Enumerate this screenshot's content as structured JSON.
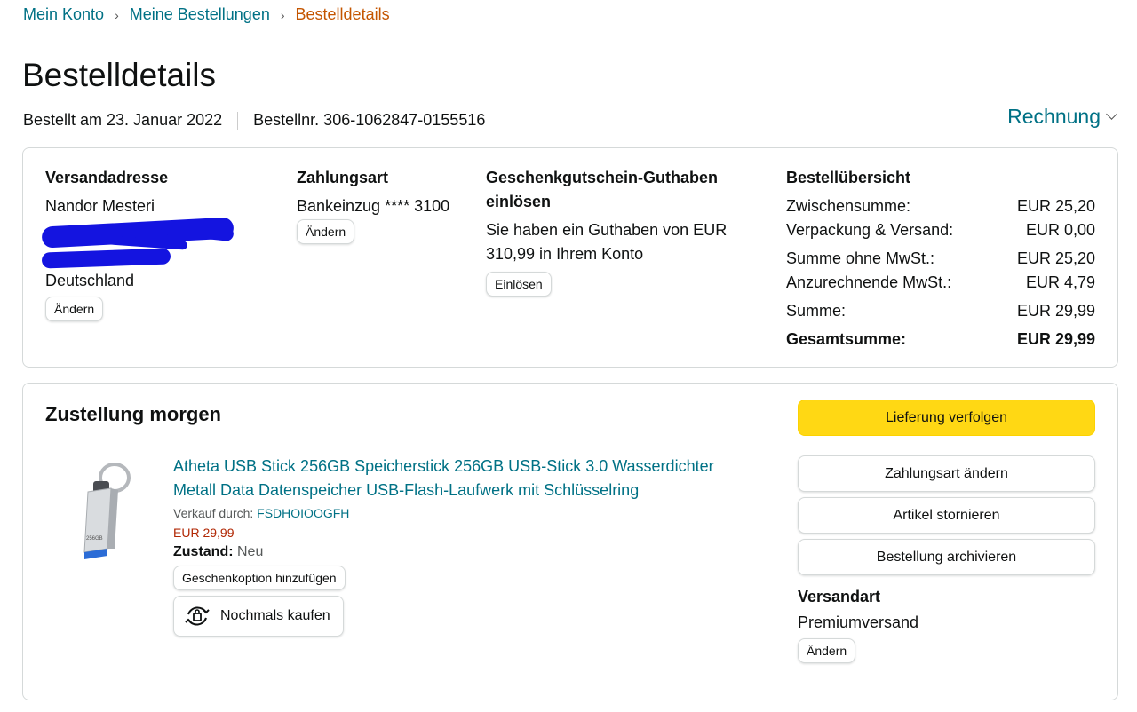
{
  "breadcrumb": {
    "items": [
      "Mein Konto",
      "Meine Bestellungen"
    ],
    "current": "Bestelldetails"
  },
  "page": {
    "title": "Bestelldetails",
    "ordered_on": "Bestellt am 23. Januar 2022",
    "order_number": "Bestellnr. 306-1062847-0155516",
    "invoice_label": "Rechnung"
  },
  "address": {
    "title": "Versandadresse",
    "name": "Nandor Mesteri",
    "country": "Deutschland",
    "change_label": "Ändern"
  },
  "payment": {
    "title": "Zahlungsart",
    "method": "Bankeinzug **** 3100",
    "change_label": "Ändern"
  },
  "giftcard": {
    "title": "Geschenkgutschein-Guthaben einlösen",
    "text": "Sie haben ein Guthaben von EUR 310,99 in Ihrem Konto",
    "redeem_label": "Einlösen"
  },
  "summary": {
    "title": "Bestellübersicht",
    "rows": [
      {
        "label": "Zwischensumme:",
        "value": "EUR 25,20"
      },
      {
        "label": "Verpackung & Versand:",
        "value": "EUR 0,00"
      },
      {
        "label": "Summe ohne MwSt.:",
        "value": "EUR 25,20"
      },
      {
        "label": "Anzurechnende MwSt.:",
        "value": "EUR 4,79"
      },
      {
        "label": "Summe:",
        "value": "EUR 29,99"
      }
    ],
    "total_label": "Gesamtsumme:",
    "total_value": "EUR 29,99"
  },
  "shipment": {
    "title": "Zustellung morgen",
    "product_title": "Atheta USB Stick 256GB Speicherstick 256GB USB-Stick 3.0 Wasserdichter Metall Data Datenspeicher USB-Flash-Laufwerk mit Schlüsselring",
    "seller_prefix": "Verkauf durch: ",
    "seller": "FSDHOIOOGFH",
    "price": "EUR 29,99",
    "condition_label": "Zustand:",
    "condition_value": " Neu",
    "gift_label": "Geschenkoption hinzufügen",
    "rebuy_label": "Nochmals kaufen",
    "product_image_label": "256GB"
  },
  "actions": {
    "track": "Lieferung verfolgen",
    "change_payment": "Zahlungsart ändern",
    "cancel": "Artikel stornieren",
    "archive": "Bestellung archivieren",
    "ship_method_title": "Versandart",
    "ship_method": "Premiumversand",
    "change_label": "Ändern"
  },
  "colors": {
    "link": "#007185",
    "current": "#c45500",
    "price": "#b12704",
    "primary": "#ffd814"
  }
}
